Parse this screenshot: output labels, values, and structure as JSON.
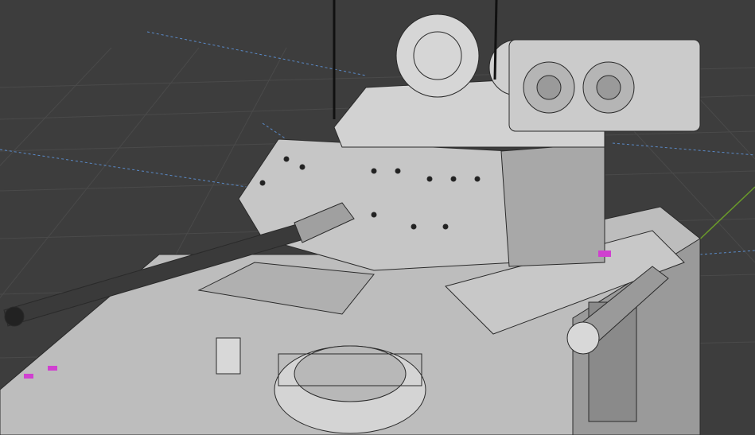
{
  "viewport": {
    "background_color": "#3d3d3d",
    "grid_color": "#4a4a4a",
    "y_axis_color": "#6a9a2a",
    "light_guide_color": "#5a8ac8",
    "model_color": "#c4c4c4",
    "model_shadow_color": "#8a8a8a",
    "wire_color": "#222222",
    "selection_color": "#d040d0"
  }
}
